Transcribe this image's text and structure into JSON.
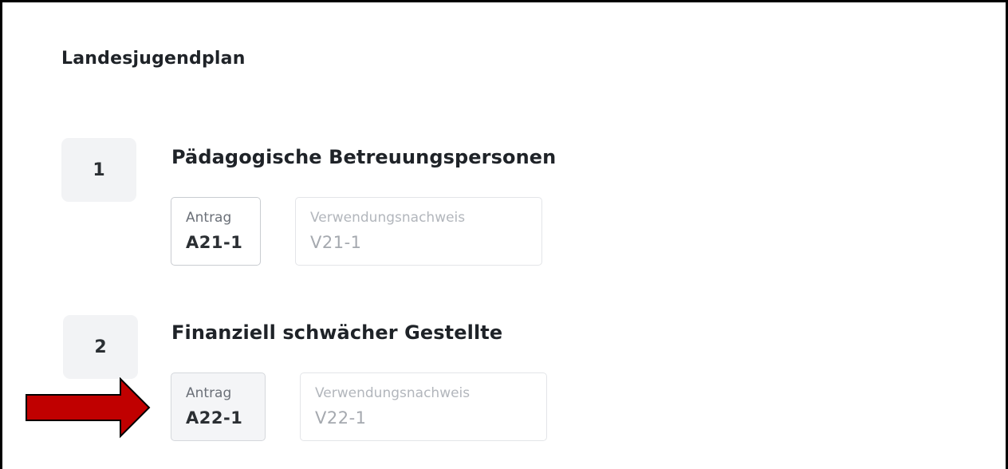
{
  "section": {
    "title": "Landesjugendplan"
  },
  "steps": [
    {
      "number": "1",
      "title": "Pädagogische Betreuungspersonen",
      "docs": [
        {
          "label": "Antrag",
          "code": "A21-1"
        },
        {
          "label": "Verwendungsnachweis",
          "code": "V21-1"
        }
      ]
    },
    {
      "number": "2",
      "title": "Finanziell schwächer Gestellte",
      "docs": [
        {
          "label": "Antrag",
          "code": "A22-1"
        },
        {
          "label": "Verwendungsnachweis",
          "code": "V22-1"
        }
      ]
    }
  ],
  "annotation": {
    "arrow_icon": "red-right-arrow-icon",
    "arrow_color": "#c00000",
    "arrow_outline": "#000000"
  }
}
